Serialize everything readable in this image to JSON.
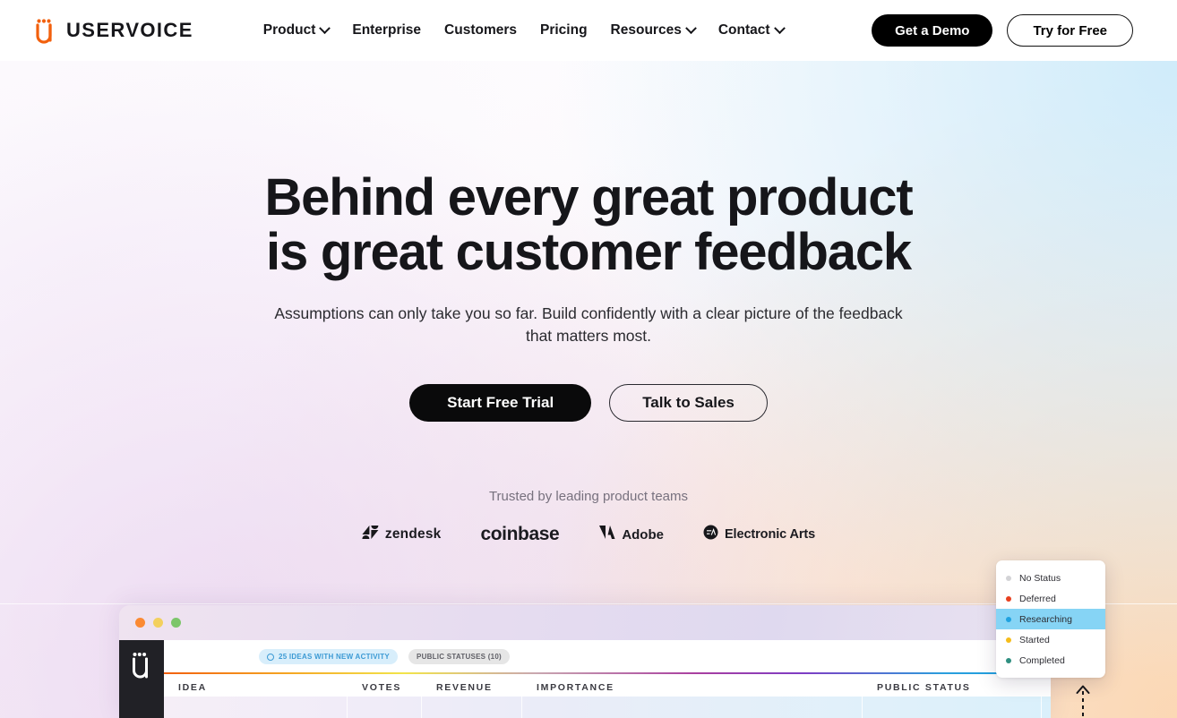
{
  "nav": {
    "brand": "USERVOICE",
    "brand_mark_icon": "uservoice-logo-icon",
    "links": [
      {
        "label": "Product",
        "has_caret": true
      },
      {
        "label": "Enterprise",
        "has_caret": false
      },
      {
        "label": "Customers",
        "has_caret": false
      },
      {
        "label": "Pricing",
        "has_caret": false
      },
      {
        "label": "Resources",
        "has_caret": true
      },
      {
        "label": "Contact",
        "has_caret": true
      }
    ],
    "demo_button": "Get a Demo",
    "trial_button": "Try for Free"
  },
  "hero": {
    "headline_line1": "Behind every great product",
    "headline_line2": "is great customer feedback",
    "subhead": "Assumptions can only take you so far. Build confidently with a clear picture of the feedback that matters most.",
    "cta_primary": "Start Free Trial",
    "cta_secondary": "Talk to Sales"
  },
  "trusted": {
    "label": "Trusted by leading product teams",
    "logos": [
      {
        "name": "zendesk",
        "icon": "zendesk-logo-icon"
      },
      {
        "name": "coinbase",
        "icon": "coinbase-logo-icon"
      },
      {
        "name": "Adobe",
        "icon": "adobe-logo-icon"
      },
      {
        "name": "Electronic Arts",
        "icon": "ea-logo-icon"
      }
    ]
  },
  "status_menu": {
    "items": [
      {
        "label": "No Status",
        "color": "#d3d3d6",
        "selected": false
      },
      {
        "label": "Deferred",
        "color": "#e8401f",
        "selected": false
      },
      {
        "label": "Researching",
        "color": "#1fa2e0",
        "selected": true
      },
      {
        "label": "Started",
        "color": "#f5bc1a",
        "selected": false
      },
      {
        "label": "Completed",
        "color": "#2f8f80",
        "selected": false
      }
    ]
  },
  "mockup": {
    "traffic_lights": [
      "#fb8a33",
      "#f3d05e",
      "#7cc66a"
    ],
    "rail_icon": "uservoice-mark-icon",
    "chips": [
      {
        "label": "25 IDEAS WITH NEW ACTIVITY",
        "icon": "check-circle-icon",
        "style": "blue"
      },
      {
        "label": "PUBLIC STATUSES (10)",
        "icon": "",
        "style": "grey"
      }
    ],
    "columns": [
      "IDEA",
      "VOTES",
      "REVENUE",
      "IMPORTANCE",
      "PUBLIC STATUS"
    ],
    "accent_rule_colors": [
      "#f2600d",
      "#f5a623",
      "#f2e44a",
      "#a93fa0",
      "#1aa0e0"
    ]
  },
  "decor": {
    "up_arrow_icon": "dashed-up-arrow-icon"
  }
}
